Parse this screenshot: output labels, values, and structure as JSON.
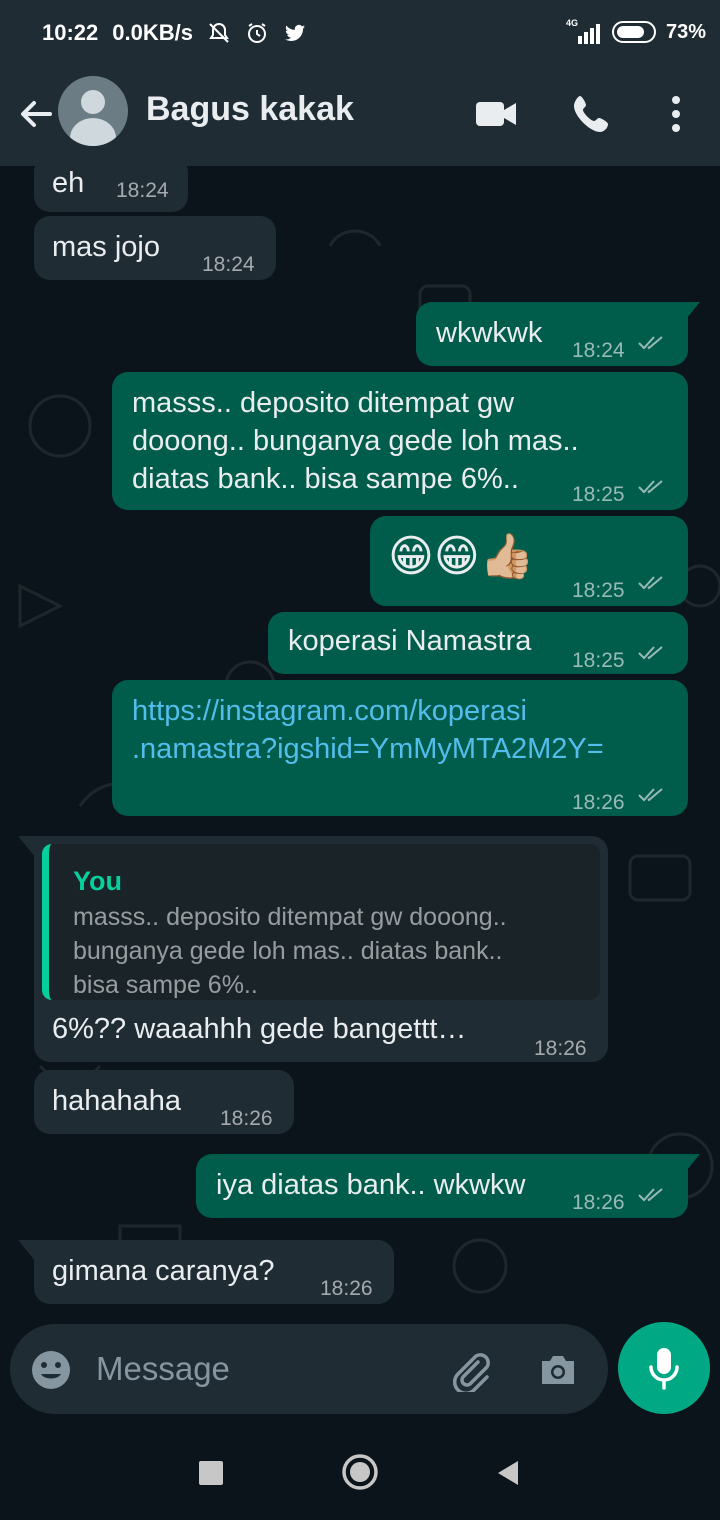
{
  "status_bar": {
    "time": "10:22",
    "net_speed": "0.0KB/s",
    "network": "4G",
    "battery": "73%"
  },
  "header": {
    "contact_name": "Bagus kakak"
  },
  "messages": [
    {
      "dir": "in",
      "text": "eh",
      "time": "18:24"
    },
    {
      "dir": "in",
      "text": "mas jojo",
      "time": "18:24"
    },
    {
      "dir": "out",
      "text": "wkwkwk",
      "time": "18:24"
    },
    {
      "dir": "out",
      "lines": [
        "masss.. deposito ditempat gw",
        "dooong.. bunganya gede loh mas..",
        "diatas bank.. bisa sampe 6%.."
      ],
      "time": "18:25"
    },
    {
      "dir": "out",
      "text": "😁😁👍🏼",
      "time": "18:25"
    },
    {
      "dir": "out",
      "text": "koperasi Namastra",
      "time": "18:25"
    },
    {
      "dir": "out",
      "lines": [
        "https://instagram.com/koperasi",
        ".namastra?igshid=YmMyMTA2M2Y="
      ],
      "time": "18:26"
    },
    {
      "dir": "in",
      "quote_author": "You",
      "quote_lines": [
        "masss.. deposito ditempat gw dooong..",
        "bunganya gede loh mas.. diatas bank..",
        "bisa sampe 6%.."
      ],
      "text": "6%?? waaahhh gede bangettt…",
      "time": "18:26"
    },
    {
      "dir": "in",
      "text": "hahahaha",
      "time": "18:26"
    },
    {
      "dir": "out",
      "text": "iya diatas bank.. wkwkw",
      "time": "18:26"
    },
    {
      "dir": "in",
      "text": "gimana caranya?",
      "time": "18:26"
    }
  ],
  "input": {
    "placeholder": "Message"
  },
  "colors": {
    "outgoing_bubble": "#005c4b",
    "incoming_bubble": "#202c33",
    "accent": "#00a884",
    "link": "#53bdeb"
  },
  "icons": [
    "back-arrow-icon",
    "video-call-icon",
    "phone-icon",
    "more-options-icon",
    "emoji-icon",
    "attach-icon",
    "camera-icon",
    "mic-icon",
    "read-ticks-icon"
  ]
}
